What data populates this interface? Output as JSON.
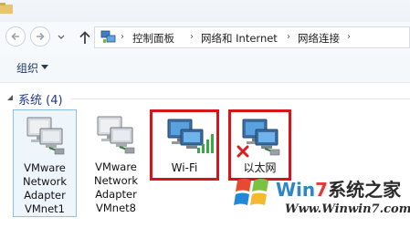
{
  "address_bar": {
    "crumbs": [
      "控制面板",
      "网络和 Internet",
      "网络连接"
    ]
  },
  "command_bar": {
    "organize_label": "组织"
  },
  "group": {
    "title": "系统 (4)"
  },
  "adapters": [
    {
      "label": "VMware Network Adapter VMnet1",
      "label_lines": [
        "VMware",
        "Network",
        "Adapter",
        "VMnet1"
      ],
      "selected": true
    },
    {
      "label": "VMware Network Adapter VMnet8",
      "label_lines": [
        "VMware",
        "Network",
        "Adapter",
        "VMnet8"
      ]
    },
    {
      "label": "Wi-Fi",
      "label_lines": [
        "Wi-Fi"
      ],
      "highlighted": true,
      "status_icon": "signal-bars-icon"
    },
    {
      "label": "以太网",
      "label_lines": [
        "以太网"
      ],
      "highlighted": true,
      "status_icon": "disconnected-x-icon"
    }
  ],
  "watermark": {
    "title_prefix": "Win",
    "title_number": "7",
    "title_suffix": "系统之家",
    "url": "Www.Winwin7.com"
  },
  "colors": {
    "highlight_border": "#d6151b",
    "selection_border": "#8ac1e6",
    "group_title": "#1e3a8a",
    "watermark_blue": "#2e86c9"
  }
}
